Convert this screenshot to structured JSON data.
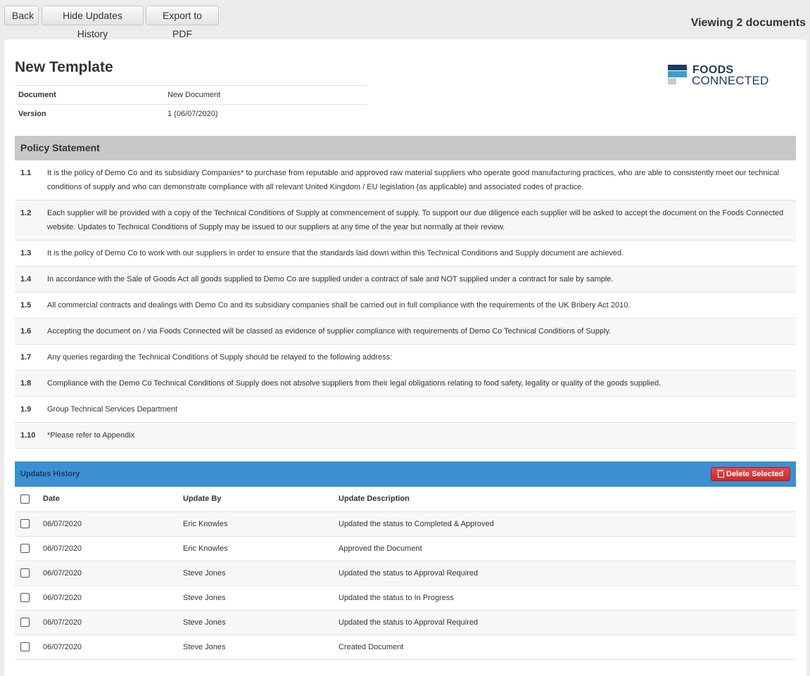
{
  "toolbar": {
    "back_label": "Back",
    "hide_history_label": "Hide Updates History",
    "export_label": "Export to PDF",
    "viewing_text": "Viewing 2 documents"
  },
  "document": {
    "title": "New Template",
    "meta": [
      {
        "key": "Document",
        "value": "New Document"
      },
      {
        "key": "Version",
        "value": "1 (06/07/2020)"
      }
    ]
  },
  "logo": {
    "line1": "FOODS",
    "line2": "CONNECTED"
  },
  "policy": {
    "heading": "Policy Statement",
    "items": [
      {
        "num": "1.1",
        "text": "It is the policy of Demo Co and its subsidiary Companies* to purchase from reputable and approved raw material suppliers who operate good manufacturing practices, who are able to consistently meet our technical conditions of supply and who can demonstrate compliance with all relevant United Kingdom / EU legislation (as applicable) and associated codes of practice."
      },
      {
        "num": "1.2",
        "text": "Each supplier will be provided with a copy of the Technical Conditions of Supply at commencement of supply.  To support our due diligence each supplier will be asked to accept the document on the Foods Connected website.  Updates to Technical Conditions of Supply may be issued to our suppliers at any time of the year but normally at their review."
      },
      {
        "num": "1.3",
        "text": "It is the policy of Demo Co to work with our suppliers in order to ensure that the standards laid down within this Technical Conditions and Supply document are achieved."
      },
      {
        "num": "1.4",
        "text": "In accordance with the Sale of Goods Act all goods supplied to Demo Co are supplied under a contract of sale and NOT supplied under a contract for sale by sample."
      },
      {
        "num": "1.5",
        "text": "All commercial contracts and dealings with Demo Co and its subsidiary companies shall be carried out in full compliance with the requirements of the UK Bribery Act 2010."
      },
      {
        "num": "1.6",
        "text": "Accepting the document on / via Foods Connected will be classed as evidence of supplier compliance with requirements of Demo Co Technical Conditions of Supply."
      },
      {
        "num": "1.7",
        "text": "Any queries regarding the Technical Conditions of Supply should be relayed to the following address:"
      },
      {
        "num": "1.8",
        "text": "Compliance with the Demo Co Technical Conditions of Supply does not absolve suppliers from their legal obligations relating to food safety, legality or quality of the goods supplied."
      },
      {
        "num": "1.9",
        "text": "Group Technical Services Department"
      },
      {
        "num": "1.10",
        "text": "*Please refer to Appendix"
      }
    ]
  },
  "updates": {
    "heading": "Updates History",
    "delete_label": "Delete Selected",
    "columns": [
      "Date",
      "Update By",
      "Update Description"
    ],
    "rows": [
      {
        "date": "06/07/2020",
        "by": "Eric Knowles",
        "desc": "Updated the status to Completed & Approved"
      },
      {
        "date": "06/07/2020",
        "by": "Eric Knowles",
        "desc": "Approved the Document"
      },
      {
        "date": "06/07/2020",
        "by": "Steve Jones",
        "desc": "Updated the status to Approval Required"
      },
      {
        "date": "06/07/2020",
        "by": "Steve Jones",
        "desc": "Updated the status to In Progress"
      },
      {
        "date": "06/07/2020",
        "by": "Steve Jones",
        "desc": "Updated the status to Approval Required"
      },
      {
        "date": "06/07/2020",
        "by": "Steve Jones",
        "desc": "Created Document"
      }
    ]
  },
  "colors": {
    "updates_header": "#3b8fd3",
    "delete_button": "#d63a3a",
    "policy_header": "#c8c8c8",
    "logo_navy": "#1f3b5e",
    "logo_blue": "#3aa0cf"
  },
  "icons": {
    "delete": "trash-icon"
  }
}
